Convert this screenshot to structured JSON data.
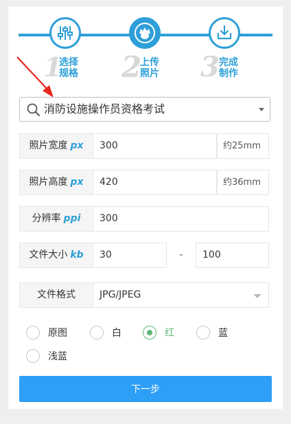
{
  "steps": [
    {
      "num": "1",
      "line1": "选择",
      "line2": "规格",
      "icon": "sliders-icon"
    },
    {
      "num": "2",
      "line1": "上传",
      "line2": "照片",
      "icon": "person-photo-icon"
    },
    {
      "num": "3",
      "line1": "完成",
      "line2": "制作",
      "icon": "download-icon"
    }
  ],
  "spec_select": {
    "value": "消防设施操作员资格考试"
  },
  "fields": {
    "width": {
      "label": "照片宽度",
      "unit": "px",
      "value": "300",
      "approx": "约25mm"
    },
    "height": {
      "label": "照片高度",
      "unit": "px",
      "value": "420",
      "approx": "约36mm"
    },
    "dpi": {
      "label": "分辨率",
      "unit": "ppi",
      "value": "300"
    },
    "filesize": {
      "label": "文件大小",
      "unit": "kb",
      "min": "30",
      "dash": "-",
      "max": "100"
    },
    "format": {
      "label": "文件格式",
      "value": "JPG/JPEG"
    }
  },
  "background_options": [
    {
      "label": "原图",
      "selected": false
    },
    {
      "label": "白",
      "selected": false
    },
    {
      "label": "红",
      "selected": true
    },
    {
      "label": "蓝",
      "selected": false
    },
    {
      "label": "浅蓝",
      "selected": false
    }
  ],
  "next_button": "下一步",
  "colors": {
    "accent": "#2e9fd8",
    "selected_radio": "#5fb878",
    "arrow": "#e8261c",
    "button": "#2e9ff7"
  }
}
